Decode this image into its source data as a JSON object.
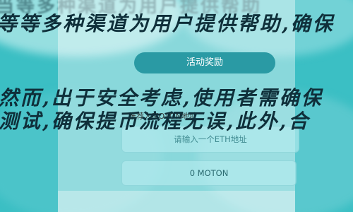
{
  "background": {
    "line_top": "当等多种渠道为用户提供帮助",
    "line1": "等等多种渠道为用户提供帮助,确保",
    "line2": "然而,出于安全考虑,使用者需确保",
    "line3": "测试,确保提币流程无误,此外,合",
    "color_teal": "#3bbfc4"
  },
  "card": {
    "activity_button_label": "活动奖励",
    "referrer_label": "推荐人MOTON地址",
    "eth_placeholder": "请输入一个ETH地址",
    "moton_value": "0 MOTON",
    "accent_color": "#2a9aa4"
  }
}
